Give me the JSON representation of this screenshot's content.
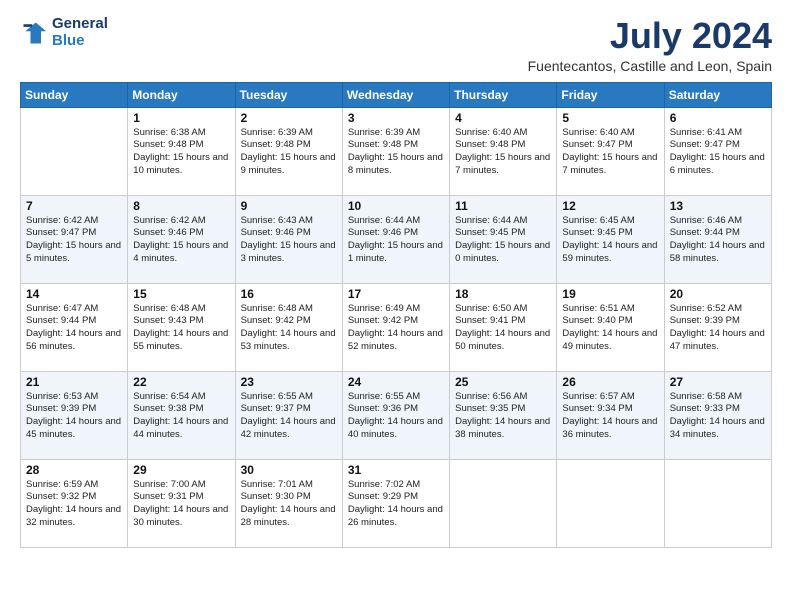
{
  "logo": {
    "line1": "General",
    "line2": "Blue"
  },
  "title": "July 2024",
  "location": "Fuentecantos, Castille and Leon, Spain",
  "weekdays": [
    "Sunday",
    "Monday",
    "Tuesday",
    "Wednesday",
    "Thursday",
    "Friday",
    "Saturday"
  ],
  "weeks": [
    [
      {
        "day": "",
        "sunrise": "",
        "sunset": "",
        "daylight": ""
      },
      {
        "day": "1",
        "sunrise": "Sunrise: 6:38 AM",
        "sunset": "Sunset: 9:48 PM",
        "daylight": "Daylight: 15 hours and 10 minutes."
      },
      {
        "day": "2",
        "sunrise": "Sunrise: 6:39 AM",
        "sunset": "Sunset: 9:48 PM",
        "daylight": "Daylight: 15 hours and 9 minutes."
      },
      {
        "day": "3",
        "sunrise": "Sunrise: 6:39 AM",
        "sunset": "Sunset: 9:48 PM",
        "daylight": "Daylight: 15 hours and 8 minutes."
      },
      {
        "day": "4",
        "sunrise": "Sunrise: 6:40 AM",
        "sunset": "Sunset: 9:48 PM",
        "daylight": "Daylight: 15 hours and 7 minutes."
      },
      {
        "day": "5",
        "sunrise": "Sunrise: 6:40 AM",
        "sunset": "Sunset: 9:47 PM",
        "daylight": "Daylight: 15 hours and 7 minutes."
      },
      {
        "day": "6",
        "sunrise": "Sunrise: 6:41 AM",
        "sunset": "Sunset: 9:47 PM",
        "daylight": "Daylight: 15 hours and 6 minutes."
      }
    ],
    [
      {
        "day": "7",
        "sunrise": "Sunrise: 6:42 AM",
        "sunset": "Sunset: 9:47 PM",
        "daylight": "Daylight: 15 hours and 5 minutes."
      },
      {
        "day": "8",
        "sunrise": "Sunrise: 6:42 AM",
        "sunset": "Sunset: 9:46 PM",
        "daylight": "Daylight: 15 hours and 4 minutes."
      },
      {
        "day": "9",
        "sunrise": "Sunrise: 6:43 AM",
        "sunset": "Sunset: 9:46 PM",
        "daylight": "Daylight: 15 hours and 3 minutes."
      },
      {
        "day": "10",
        "sunrise": "Sunrise: 6:44 AM",
        "sunset": "Sunset: 9:46 PM",
        "daylight": "Daylight: 15 hours and 1 minute."
      },
      {
        "day": "11",
        "sunrise": "Sunrise: 6:44 AM",
        "sunset": "Sunset: 9:45 PM",
        "daylight": "Daylight: 15 hours and 0 minutes."
      },
      {
        "day": "12",
        "sunrise": "Sunrise: 6:45 AM",
        "sunset": "Sunset: 9:45 PM",
        "daylight": "Daylight: 14 hours and 59 minutes."
      },
      {
        "day": "13",
        "sunrise": "Sunrise: 6:46 AM",
        "sunset": "Sunset: 9:44 PM",
        "daylight": "Daylight: 14 hours and 58 minutes."
      }
    ],
    [
      {
        "day": "14",
        "sunrise": "Sunrise: 6:47 AM",
        "sunset": "Sunset: 9:44 PM",
        "daylight": "Daylight: 14 hours and 56 minutes."
      },
      {
        "day": "15",
        "sunrise": "Sunrise: 6:48 AM",
        "sunset": "Sunset: 9:43 PM",
        "daylight": "Daylight: 14 hours and 55 minutes."
      },
      {
        "day": "16",
        "sunrise": "Sunrise: 6:48 AM",
        "sunset": "Sunset: 9:42 PM",
        "daylight": "Daylight: 14 hours and 53 minutes."
      },
      {
        "day": "17",
        "sunrise": "Sunrise: 6:49 AM",
        "sunset": "Sunset: 9:42 PM",
        "daylight": "Daylight: 14 hours and 52 minutes."
      },
      {
        "day": "18",
        "sunrise": "Sunrise: 6:50 AM",
        "sunset": "Sunset: 9:41 PM",
        "daylight": "Daylight: 14 hours and 50 minutes."
      },
      {
        "day": "19",
        "sunrise": "Sunrise: 6:51 AM",
        "sunset": "Sunset: 9:40 PM",
        "daylight": "Daylight: 14 hours and 49 minutes."
      },
      {
        "day": "20",
        "sunrise": "Sunrise: 6:52 AM",
        "sunset": "Sunset: 9:39 PM",
        "daylight": "Daylight: 14 hours and 47 minutes."
      }
    ],
    [
      {
        "day": "21",
        "sunrise": "Sunrise: 6:53 AM",
        "sunset": "Sunset: 9:39 PM",
        "daylight": "Daylight: 14 hours and 45 minutes."
      },
      {
        "day": "22",
        "sunrise": "Sunrise: 6:54 AM",
        "sunset": "Sunset: 9:38 PM",
        "daylight": "Daylight: 14 hours and 44 minutes."
      },
      {
        "day": "23",
        "sunrise": "Sunrise: 6:55 AM",
        "sunset": "Sunset: 9:37 PM",
        "daylight": "Daylight: 14 hours and 42 minutes."
      },
      {
        "day": "24",
        "sunrise": "Sunrise: 6:55 AM",
        "sunset": "Sunset: 9:36 PM",
        "daylight": "Daylight: 14 hours and 40 minutes."
      },
      {
        "day": "25",
        "sunrise": "Sunrise: 6:56 AM",
        "sunset": "Sunset: 9:35 PM",
        "daylight": "Daylight: 14 hours and 38 minutes."
      },
      {
        "day": "26",
        "sunrise": "Sunrise: 6:57 AM",
        "sunset": "Sunset: 9:34 PM",
        "daylight": "Daylight: 14 hours and 36 minutes."
      },
      {
        "day": "27",
        "sunrise": "Sunrise: 6:58 AM",
        "sunset": "Sunset: 9:33 PM",
        "daylight": "Daylight: 14 hours and 34 minutes."
      }
    ],
    [
      {
        "day": "28",
        "sunrise": "Sunrise: 6:59 AM",
        "sunset": "Sunset: 9:32 PM",
        "daylight": "Daylight: 14 hours and 32 minutes."
      },
      {
        "day": "29",
        "sunrise": "Sunrise: 7:00 AM",
        "sunset": "Sunset: 9:31 PM",
        "daylight": "Daylight: 14 hours and 30 minutes."
      },
      {
        "day": "30",
        "sunrise": "Sunrise: 7:01 AM",
        "sunset": "Sunset: 9:30 PM",
        "daylight": "Daylight: 14 hours and 28 minutes."
      },
      {
        "day": "31",
        "sunrise": "Sunrise: 7:02 AM",
        "sunset": "Sunset: 9:29 PM",
        "daylight": "Daylight: 14 hours and 26 minutes."
      },
      {
        "day": "",
        "sunrise": "",
        "sunset": "",
        "daylight": ""
      },
      {
        "day": "",
        "sunrise": "",
        "sunset": "",
        "daylight": ""
      },
      {
        "day": "",
        "sunrise": "",
        "sunset": "",
        "daylight": ""
      }
    ]
  ]
}
